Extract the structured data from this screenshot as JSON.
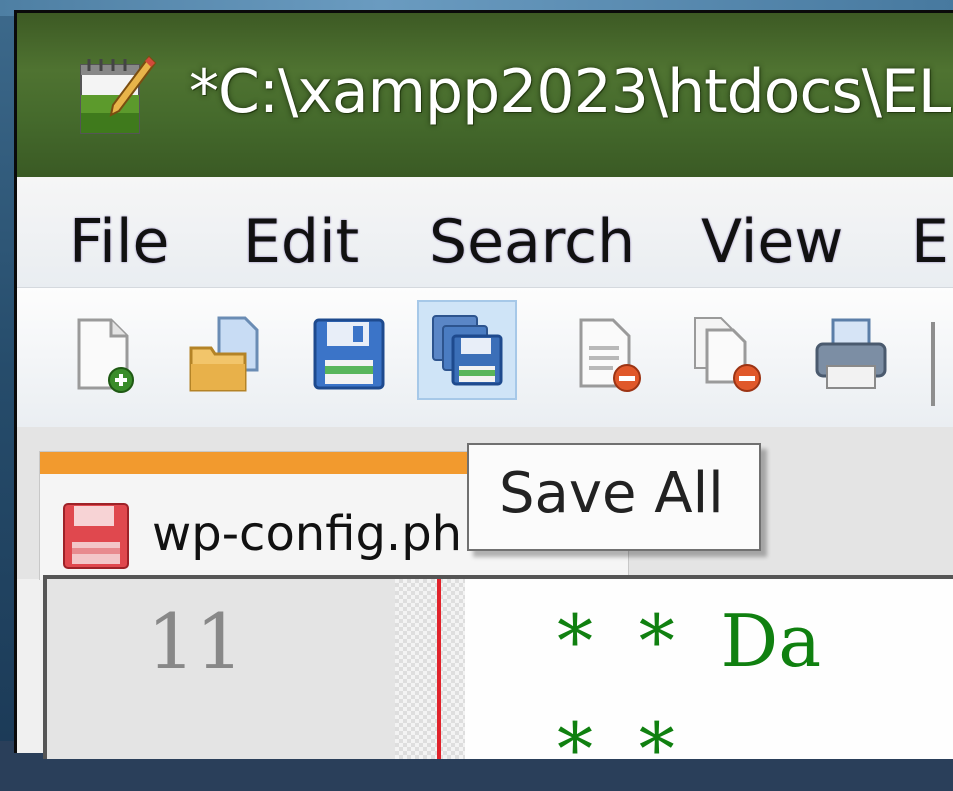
{
  "window": {
    "title": "*C:\\xampp2023\\htdocs\\EL"
  },
  "menu": {
    "items": [
      "File",
      "Edit",
      "Search",
      "View",
      "E"
    ]
  },
  "toolbar": {
    "buttons": [
      {
        "name": "new-file",
        "icon": "new-file-icon"
      },
      {
        "name": "open-file",
        "icon": "open-folder-icon"
      },
      {
        "name": "save",
        "icon": "save-icon"
      },
      {
        "name": "save-all",
        "icon": "save-all-icon",
        "state": "hovered"
      },
      {
        "name": "close",
        "icon": "close-file-icon"
      },
      {
        "name": "close-all",
        "icon": "close-all-icon"
      },
      {
        "name": "print",
        "icon": "print-icon"
      }
    ]
  },
  "tooltip": {
    "text": "Save All"
  },
  "tabs": [
    {
      "label": "wp-config.ph",
      "icon": "unsaved-file-icon",
      "active": true
    }
  ],
  "editor": {
    "line_number": "11",
    "code_line": "*  *  Da",
    "next_line": "*  *"
  },
  "colors": {
    "titlebar": "#4f7331",
    "tab_accent": "#f29a2e",
    "edge_line": "#e0222a",
    "comment_text": "#108010"
  }
}
